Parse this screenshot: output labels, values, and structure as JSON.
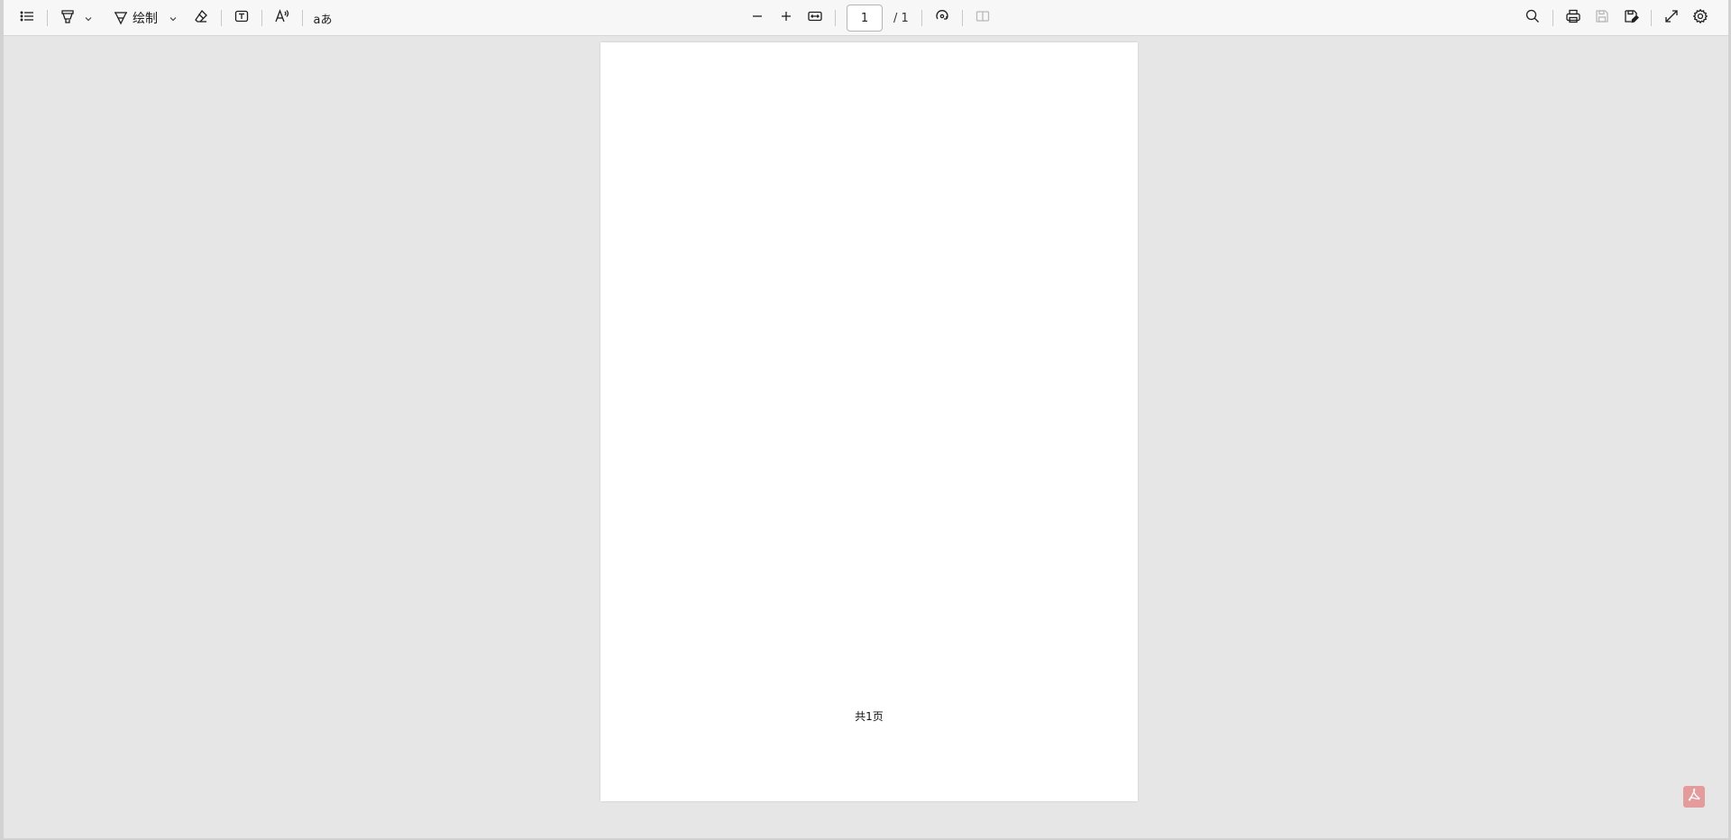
{
  "toolbar": {
    "left": {
      "sidebar_toggle_icon": "list-icon",
      "highlight_icon": "highlighter-icon",
      "draw_icon": "pen-icon",
      "draw_label": "绘制",
      "eraser_icon": "eraser-icon",
      "textbox_icon": "text-box-icon",
      "read_aloud_icon": "read-aloud-icon",
      "translate_icon": "translate-icon"
    },
    "center": {
      "zoom_out_icon": "minus-icon",
      "zoom_in_icon": "plus-icon",
      "fit_icon": "fit-width-icon",
      "page_number": "1",
      "page_total": "/ 1",
      "rotate_icon": "rotate-icon",
      "two_page_icon": "two-page-icon"
    },
    "right": {
      "search_icon": "search-icon",
      "print_icon": "print-icon",
      "save_icon": "save-icon",
      "save_as_icon": "save-as-icon",
      "fullscreen_icon": "fullscreen-icon",
      "settings_icon": "gear-icon"
    }
  },
  "document": {
    "footer_text": "共1页"
  },
  "badge": {
    "icon": "acrobat-pdf-icon",
    "color": "#e39b9b"
  }
}
